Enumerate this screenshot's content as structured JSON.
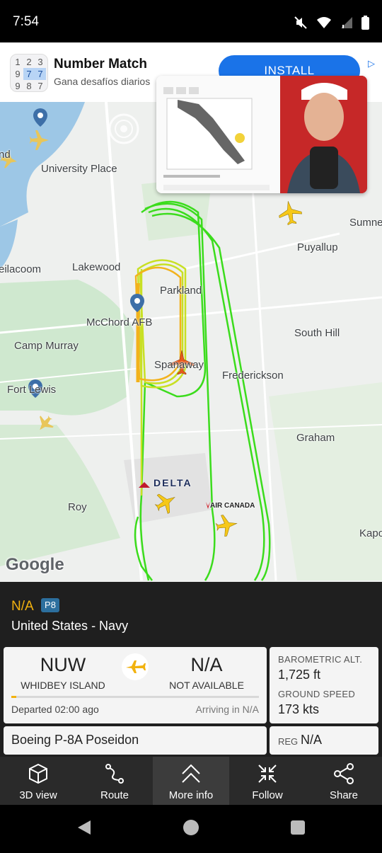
{
  "status_bar": {
    "time": "7:54"
  },
  "ad": {
    "app_name": "Number Match",
    "subtitle": "Gana desafíos diarios",
    "install_label": "INSTALL",
    "icon_digits": [
      "1",
      "2",
      "3",
      "9",
      "7",
      "7",
      "9",
      "8",
      "7"
    ]
  },
  "map": {
    "labels": [
      "University Place",
      "eilacoom",
      "Lakewood",
      "Parkland",
      "McChord AFB",
      "Camp Murray",
      "Fort Lewis",
      "Spanaway",
      "Frederickson",
      "South Hill",
      "Puyallup",
      "Sumne",
      "Graham",
      "Roy",
      "Kapo",
      "nd"
    ],
    "airline_labels": {
      "delta": "DELTA",
      "air_canada": "AIR CANADA"
    },
    "attribution": "Google",
    "track_colors": {
      "low": "#f2b21c",
      "mid": "#c8e024",
      "high": "#3bdc1c"
    }
  },
  "flight": {
    "callsign": "N/A",
    "type_code": "P8",
    "operator": "United States - Navy",
    "origin": {
      "code": "NUW",
      "name": "WHIDBEY ISLAND"
    },
    "destination": {
      "code": "N/A",
      "name": "NOT AVAILABLE"
    },
    "departed": "Departed 02:00 ago",
    "arriving": "Arriving in N/A",
    "progress_fraction": 0.02,
    "barometric_alt_label": "BAROMETRIC ALT.",
    "barometric_alt": "1,725 ft",
    "ground_speed_label": "GROUND SPEED",
    "ground_speed": "173 kts",
    "aircraft": "Boeing P-8A Poseidon",
    "reg_label": "REG",
    "reg": "N/A"
  },
  "bottom_nav": [
    {
      "label": "3D view",
      "icon": "cube-icon"
    },
    {
      "label": "Route",
      "icon": "route-icon"
    },
    {
      "label": "More info",
      "icon": "chevron-up-icon"
    },
    {
      "label": "Follow",
      "icon": "follow-icon"
    },
    {
      "label": "Share",
      "icon": "share-icon"
    }
  ],
  "colors": {
    "accent": "#f2b20f",
    "panel": "#1f1f1f",
    "nav_active": "#3c3c3c"
  }
}
